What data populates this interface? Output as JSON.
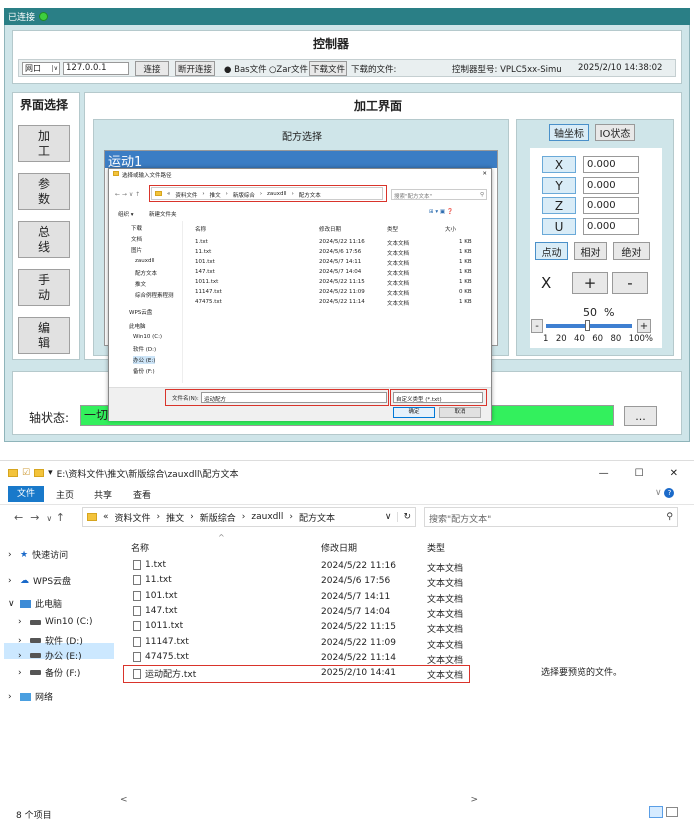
{
  "app": {
    "status": "已连接",
    "title": "控制器"
  },
  "toolbar": {
    "port_type": "网口",
    "ip": "127.0.0.1",
    "connect": "连接",
    "disconnect": "断开连接",
    "bas_radio": "Bas文件",
    "zar_radio": "Zar文件",
    "download_btn": "下载文件",
    "downloaded_label": "下载的文件:",
    "model_label": "控制器型号: VPLC5xx-Simu",
    "datetime": "2025/2/10 14:38:02"
  },
  "sidebar": {
    "title": "界面选择",
    "items": [
      "加\n工",
      "参\n数",
      "总\n线",
      "手\n动",
      "编\n辑"
    ]
  },
  "main": {
    "title": "加工界面",
    "recipe_title": "配方选择",
    "recipe_name": "运动1"
  },
  "right": {
    "tab_axis": "轴坐标",
    "tab_io": "IO状态",
    "axes": [
      {
        "name": "X",
        "value": "0.000"
      },
      {
        "name": "Y",
        "value": "0.000"
      },
      {
        "name": "Z",
        "value": "0.000"
      },
      {
        "name": "U",
        "value": "0.000"
      }
    ],
    "modes": [
      "点动",
      "相对",
      "绝对"
    ],
    "jog_axis": "X",
    "plus": "+",
    "minus": "-",
    "speed": "50",
    "speed_unit": "%",
    "speed_marks": [
      "1",
      "20",
      "40",
      "60",
      "80",
      "100%"
    ]
  },
  "status_bar": {
    "label": "轴状态:",
    "value": "一切",
    "more": "..."
  },
  "dialog": {
    "title": "选择或输入文件路径",
    "path": [
      "«",
      "资料文件",
      "推文",
      "新版综合",
      "zauxdll",
      "配方文本"
    ],
    "search": "搜索\"配方文本\"",
    "organize": "组织 ▾",
    "new_folder": "新建文件夹",
    "cols": [
      "名称",
      "修改日期",
      "类型",
      "大小"
    ],
    "tree": [
      "下载",
      "文档",
      "图片",
      "zauxdll",
      "配方文本",
      "推文",
      "综合例程素程测",
      "WPS云盘",
      "此电脑",
      "Win10 (C:)",
      "软件 (D:)",
      "办公 (E:)",
      "备份 (F:)"
    ],
    "files": [
      [
        "1.txt",
        "2024/5/22 11:16",
        "文本文档",
        "1 KB"
      ],
      [
        "11.txt",
        "2024/5/6 17:56",
        "文本文档",
        "1 KB"
      ],
      [
        "101.txt",
        "2024/5/7 14:11",
        "文本文档",
        "1 KB"
      ],
      [
        "147.txt",
        "2024/5/7 14:04",
        "文本文档",
        "1 KB"
      ],
      [
        "1011.txt",
        "2024/5/22 11:15",
        "文本文档",
        "1 KB"
      ],
      [
        "11147.txt",
        "2024/5/22 11:09",
        "文本文档",
        "0 KB"
      ],
      [
        "47475.txt",
        "2024/5/22 11:14",
        "文本文档",
        "1 KB"
      ]
    ],
    "filename_label": "文件名(N):",
    "filename": "运动配方",
    "filetype": "自定义类型 (*.txt)",
    "ok": "确定",
    "cancel": "取消"
  },
  "explorer": {
    "path": "E:\\资料文件\\推文\\新版综合\\zauxdll\\配方文本",
    "window_controls": [
      "—",
      "☐",
      "✕"
    ],
    "ribbon": [
      "文件",
      "主页",
      "共享",
      "查看"
    ],
    "crumbs": [
      "«",
      "资料文件",
      "推文",
      "新版综合",
      "zauxdll",
      "配方文本"
    ],
    "search": "搜索\"配方文本\"",
    "cols": [
      "名称",
      "修改日期",
      "类型"
    ],
    "nav": [
      "快速访问",
      "WPS云盘",
      "此电脑",
      "Win10 (C:)",
      "软件 (D:)",
      "办公 (E:)",
      "备份 (F:)",
      "网络"
    ],
    "files": [
      [
        "1.txt",
        "2024/5/22 11:16",
        "文本文档"
      ],
      [
        "11.txt",
        "2024/5/6 17:56",
        "文本文档"
      ],
      [
        "101.txt",
        "2024/5/7 14:11",
        "文本文档"
      ],
      [
        "147.txt",
        "2024/5/7 14:04",
        "文本文档"
      ],
      [
        "1011.txt",
        "2024/5/22 11:15",
        "文本文档"
      ],
      [
        "11147.txt",
        "2024/5/22 11:09",
        "文本文档"
      ],
      [
        "47475.txt",
        "2024/5/22 11:14",
        "文本文档"
      ],
      [
        "运动配方.txt",
        "2025/2/10 14:41",
        "文本文档"
      ]
    ],
    "preview": "选择要预览的文件。",
    "count": "8 个项目"
  }
}
